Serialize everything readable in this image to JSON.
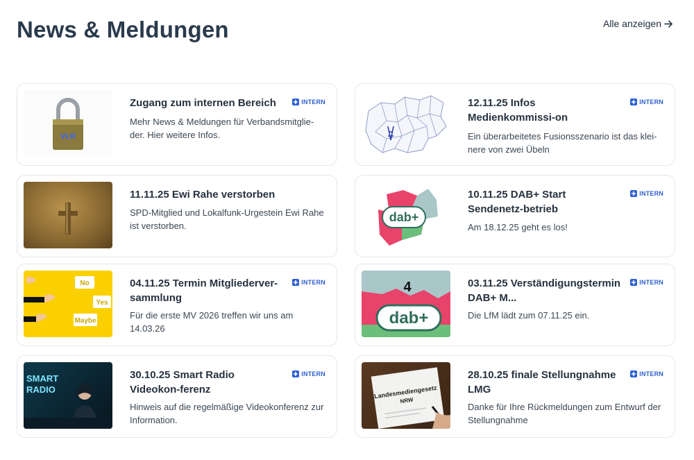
{
  "header": {
    "title": "News & Meldungen",
    "show_all_label": "Alle anzeigen"
  },
  "badge_label": "INTERN",
  "cards": [
    {
      "title": "Zugang zum internen Bereich",
      "description": "Mehr News & Meldungen für Verbandsmitglie-der. Hier weitere Infos.",
      "intern": true,
      "image": "padlock-image",
      "image_text": "VLR"
    },
    {
      "title": "12.11.25 Infos Medienkommissi-on",
      "description": "Ein überarbeitetes Fusionsszenario ist das klei-nere von zwei Übeln",
      "intern": true,
      "image": "nrw-district-map-image"
    },
    {
      "title": "11.11.25 Ewi Rahe verstorben",
      "description": "SPD-Mitglied und Lokalfunk-Urgestein Ewi Rahe ist verstorben.",
      "intern": false,
      "image": "wooden-cross-image"
    },
    {
      "title": "10.11.25 DAB+ Start Sendenetz-betrieb",
      "description": "Am 18.12.25 geht es los!",
      "intern": true,
      "image": "dab-plus-map-image",
      "image_text": "dab+"
    },
    {
      "title": "04.11.25 Termin Mitgliederver-sammlung",
      "description": "Für die erste MV 2026 treffen wir uns am 14.03.26",
      "intern": true,
      "image": "vote-hands-image",
      "image_labels": [
        "No",
        "Yes",
        "Maybe"
      ]
    },
    {
      "title": "03.11.25 Verständigungstermin DAB+ M...",
      "description": "Die LfM lädt zum 07.11.25 ein.",
      "intern": true,
      "image": "dab-plus-logo-image",
      "image_text": "dab+"
    },
    {
      "title": "30.10.25 Smart Radio Videokon-ferenz",
      "description": "Hinweis auf die regelmäßige Videokonferenz zur Information.",
      "intern": true,
      "image": "smart-radio-image",
      "image_text": "SMART RADIO"
    },
    {
      "title": "28.10.25 finale Stellungnahme LMG",
      "description": "Danke für Ihre Rückmeldungen zum Entwurf der Stellungnahme",
      "intern": true,
      "image": "landesmediengesetz-document-image",
      "image_text": "Landesmediengesetz NRW"
    }
  ],
  "colors": {
    "badge_blue": "#2e5fd2",
    "title_text": "#26323f",
    "card_border": "#e3e6ea"
  }
}
